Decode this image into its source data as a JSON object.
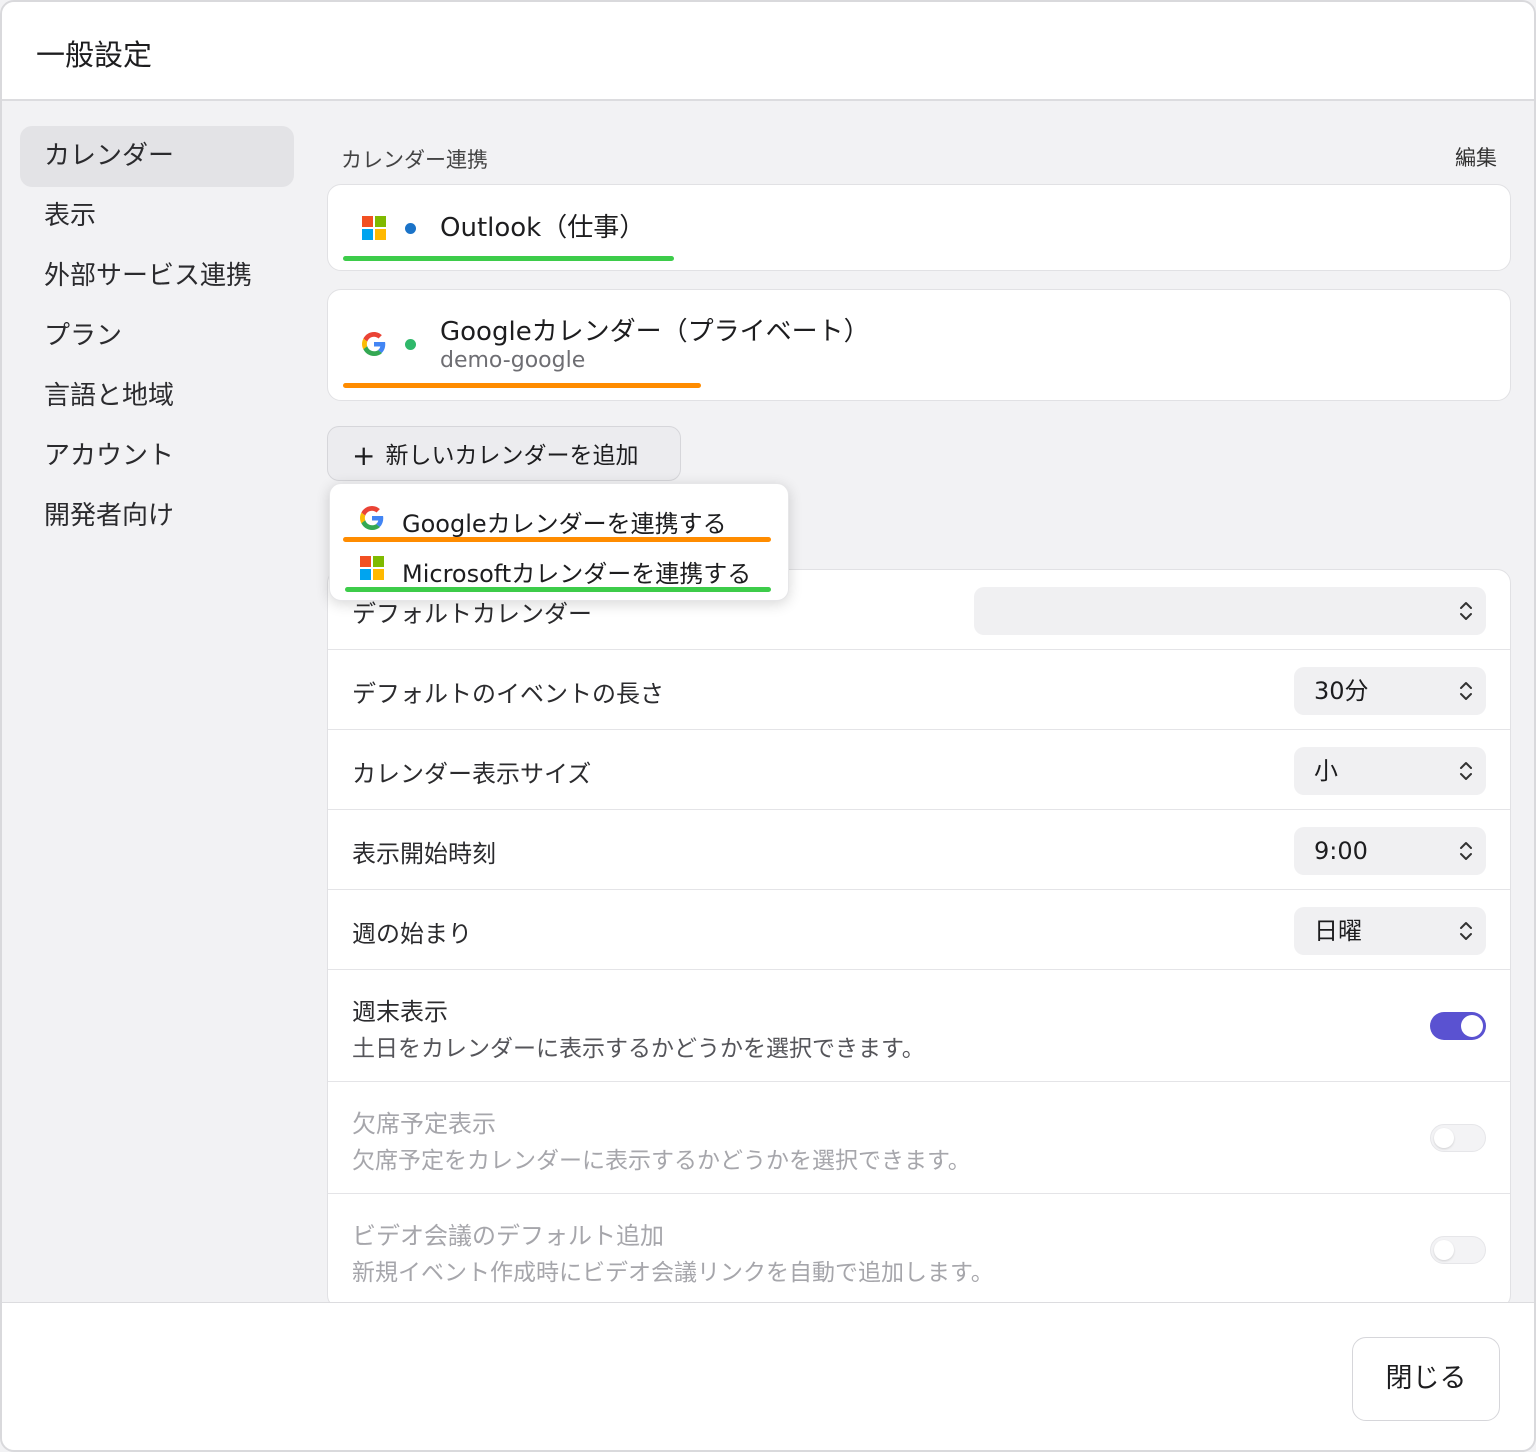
{
  "window": {
    "title": "一般設定"
  },
  "sidebar": {
    "items": [
      {
        "label": "カレンダー",
        "active": true
      },
      {
        "label": "表示"
      },
      {
        "label": "外部サービス連携"
      },
      {
        "label": "プラン"
      },
      {
        "label": "言語と地域"
      },
      {
        "label": "アカウント"
      },
      {
        "label": "開発者向け"
      }
    ]
  },
  "calendar_link": {
    "header": "カレンダー連携",
    "edit_label": "編集",
    "accounts": [
      {
        "provider": "microsoft",
        "icon": "microsoft-logo-icon",
        "dot_color": "#1a73c8",
        "name": "Outlook（仕事）",
        "underline_color": "#3dcc4a"
      },
      {
        "provider": "google",
        "icon": "google-logo-icon",
        "dot_color": "#2fb86a",
        "name": "Googleカレンダー（プライベート）",
        "subtitle": "demo-google",
        "underline_color": "#ff8c00"
      }
    ],
    "add_button": {
      "icon": "plus-icon",
      "label": "新しいカレンダーを追加"
    },
    "menu": [
      {
        "icon": "google-logo-icon",
        "label": "Googleカレンダーを連携する",
        "underline_color": "#ff8c00"
      },
      {
        "icon": "microsoft-logo-icon",
        "label": "Microsoftカレンダーを連携する",
        "underline_color": "#3dcc4a"
      }
    ]
  },
  "settings": {
    "default_calendar": {
      "label": "デフォルトカレンダー",
      "value": ""
    },
    "event_length": {
      "label": "デフォルトのイベントの長さ",
      "value": "30分"
    },
    "display_size": {
      "label": "カレンダー表示サイズ",
      "value": "小"
    },
    "start_time": {
      "label": "表示開始時刻",
      "value": "9:00"
    },
    "week_start": {
      "label": "週の始まり",
      "value": "日曜"
    },
    "weekend": {
      "label": "週末表示",
      "description": "土日をカレンダーに表示するかどうかを選択できます。",
      "enabled": true
    },
    "absence": {
      "label": "欠席予定表示",
      "description": "欠席予定をカレンダーに表示するかどうかを選択できます。",
      "enabled": false,
      "disabled": true
    },
    "video": {
      "label": "ビデオ会議のデフォルト追加",
      "description": "新規イベント作成時にビデオ会議リンクを自動で追加します。",
      "enabled": false,
      "disabled": true
    }
  },
  "footer": {
    "close_label": "閉じる"
  },
  "colors": {
    "accent": "#5a52d1",
    "ms_red": "#f25022",
    "ms_green": "#7fba00",
    "ms_blue": "#00a4ef",
    "ms_yellow": "#ffb900"
  }
}
